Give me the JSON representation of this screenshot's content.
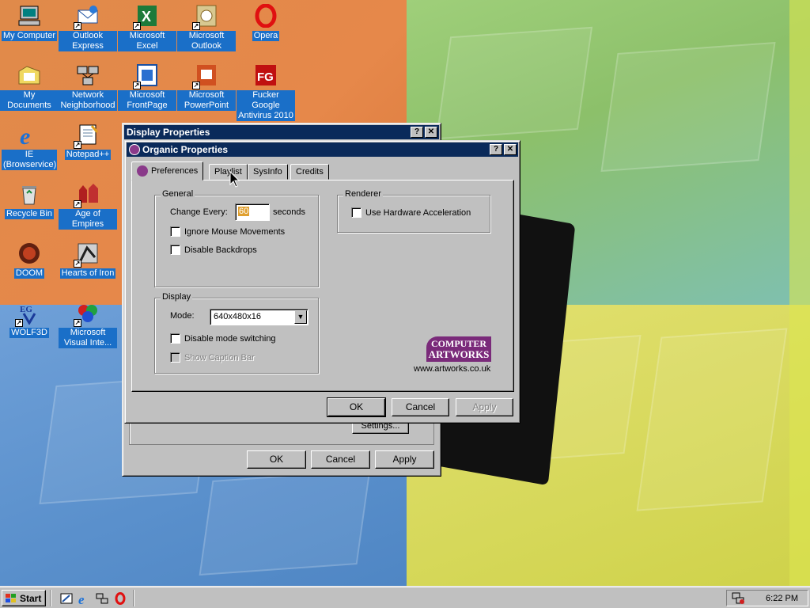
{
  "desktop": {
    "icons": [
      {
        "label": "My Computer",
        "icon": "computer-icon"
      },
      {
        "label": "Outlook Express",
        "icon": "outlook-express-icon"
      },
      {
        "label": "Microsoft Excel",
        "icon": "excel-icon"
      },
      {
        "label": "Microsoft Outlook",
        "icon": "outlook-icon"
      },
      {
        "label": "Opera",
        "icon": "opera-icon"
      },
      {
        "label": "My Documents",
        "icon": "folder-icon"
      },
      {
        "label": "Network Neighborhood",
        "icon": "network-icon"
      },
      {
        "label": "Microsoft FrontPage",
        "icon": "frontpage-icon"
      },
      {
        "label": "Microsoft PowerPoint",
        "icon": "powerpoint-icon"
      },
      {
        "label": "Fucker Google Antivirus 2010",
        "icon": "antivirus-icon"
      },
      {
        "label": "IE (Browservice)",
        "icon": "ie-icon"
      },
      {
        "label": "Notepad++",
        "icon": "notepad-icon"
      },
      {
        "label": "Recycle Bin",
        "icon": "recycle-bin-icon"
      },
      {
        "label": "Age of Empires",
        "icon": "age-of-empires-icon"
      },
      {
        "label": "DOOM",
        "icon": "doom-icon"
      },
      {
        "label": "Hearts of Iron",
        "icon": "hearts-of-iron-icon"
      },
      {
        "label": "WOLF3D",
        "icon": "wolf3d-icon"
      },
      {
        "label": "Microsoft Visual Inte...",
        "icon": "visual-interdev-icon"
      }
    ]
  },
  "display_properties": {
    "title": "Display Properties",
    "settings_label": "Settings...",
    "ok_label": "OK",
    "cancel_label": "Cancel",
    "apply_label": "Apply"
  },
  "organic": {
    "title": "Organic Properties",
    "tabs": [
      {
        "label": "Preferences"
      },
      {
        "label": "Playlist"
      },
      {
        "label": "SysInfo"
      },
      {
        "label": "Credits"
      }
    ],
    "general": {
      "title": "General",
      "change_every_label": "Change Every:",
      "change_every_value": "60",
      "seconds_label": "seconds",
      "ignore_mouse": "Ignore Mouse Movements",
      "disable_backdrops": "Disable Backdrops"
    },
    "renderer": {
      "title": "Renderer",
      "hardware_accel": "Use Hardware Acceleration"
    },
    "display": {
      "title": "Display",
      "mode_label": "Mode:",
      "mode_value": "640x480x16",
      "disable_mode_switching": "Disable mode switching",
      "show_caption_bar": "Show Caption Bar"
    },
    "logo": {
      "line1": "COMPUTER",
      "line2": "ARTWORKS",
      "url": "www.artworks.co.uk",
      "color": "#7a2a7a"
    },
    "ok_label": "OK",
    "cancel_label": "Cancel",
    "apply_label": "Apply"
  },
  "taskbar": {
    "start_label": "Start",
    "clock": "6:22 PM"
  }
}
